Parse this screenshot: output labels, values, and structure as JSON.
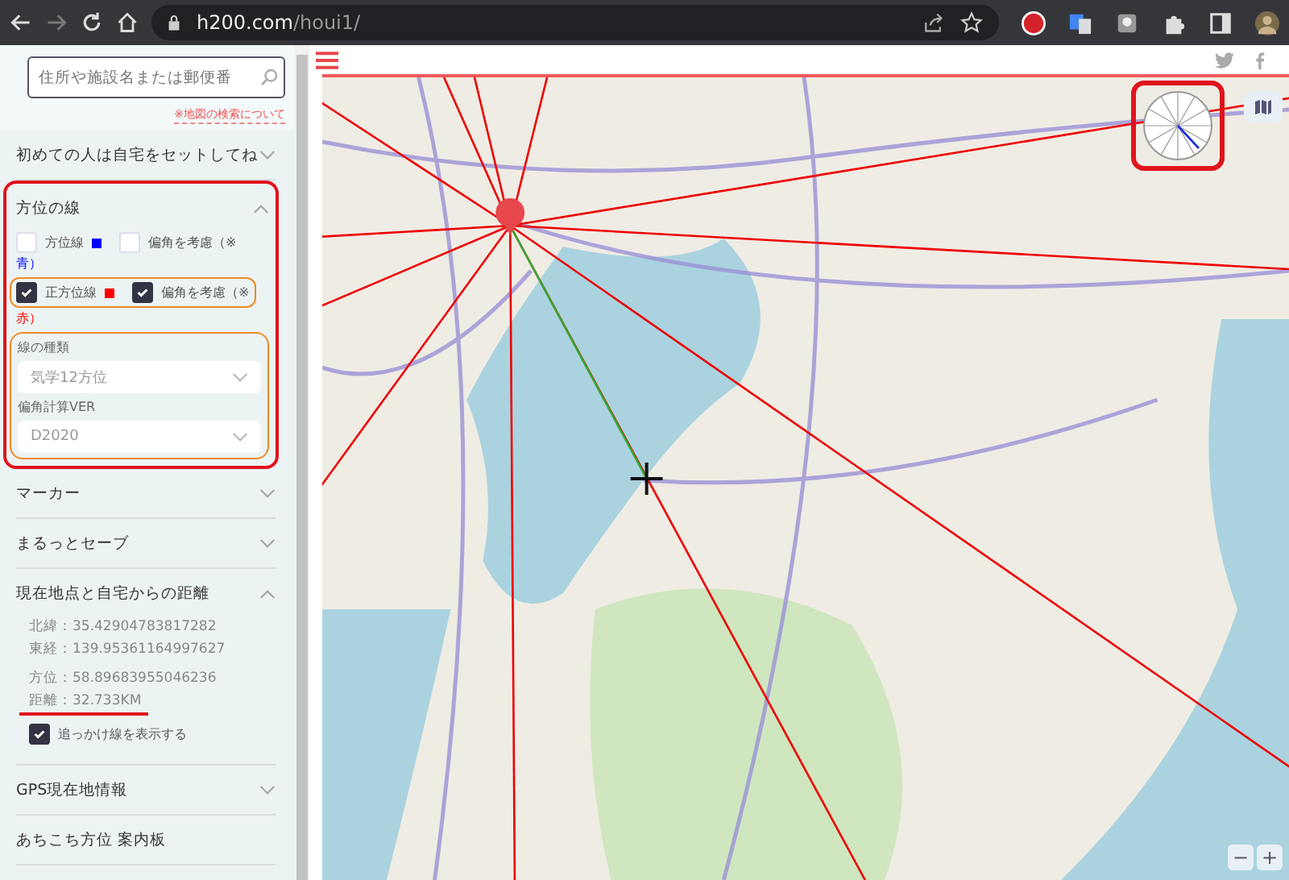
{
  "browser": {
    "url_host": "h200.com",
    "url_path": "/houi1/"
  },
  "sidebar": {
    "search": {
      "placeholder": "住所や施設名または郵便番"
    },
    "search_help_link": "※地図の検索について",
    "sections": [
      {
        "kind": "plain",
        "title": "初めての人は自宅をセットしてね",
        "expanded": false
      },
      {
        "kind": "lines",
        "title": "方位の線",
        "expanded": true,
        "rows": [
          {
            "line": {
              "label": "方位線",
              "checked": false,
              "color": "#0000ff"
            },
            "declination": {
              "label": "偏角を考慮（※",
              "checked": false
            },
            "note": "青）"
          },
          {
            "line": {
              "label": "正方位線",
              "checked": true,
              "color": "#ff0000"
            },
            "declination": {
              "label": "偏角を考慮（※",
              "checked": true
            },
            "note": "赤）"
          }
        ],
        "selects": [
          {
            "label": "線の種類",
            "value": "気学12方位"
          },
          {
            "label": "偏角計算VER",
            "value": "D2020"
          }
        ]
      },
      {
        "kind": "plain",
        "title": "マーカー",
        "expanded": false
      },
      {
        "kind": "plain",
        "title": "まるっとセーブ",
        "expanded": false
      },
      {
        "kind": "info",
        "title": "現在地点と自宅からの距離",
        "expanded": true,
        "lines": [
          "北緯：35.42904783817282",
          "東経：139.95361164997627",
          "方位：58.89683955046236",
          "距離：32.733KM"
        ],
        "checkbox": {
          "label": "追っかけ線を表示する",
          "checked": true
        }
      },
      {
        "kind": "plain",
        "title": "GPS現在地情報",
        "expanded": false
      },
      {
        "kind": "link",
        "title": "あちこち方位 案内板"
      }
    ]
  },
  "map": {
    "zoom_buttons": [
      "−",
      "+"
    ]
  }
}
